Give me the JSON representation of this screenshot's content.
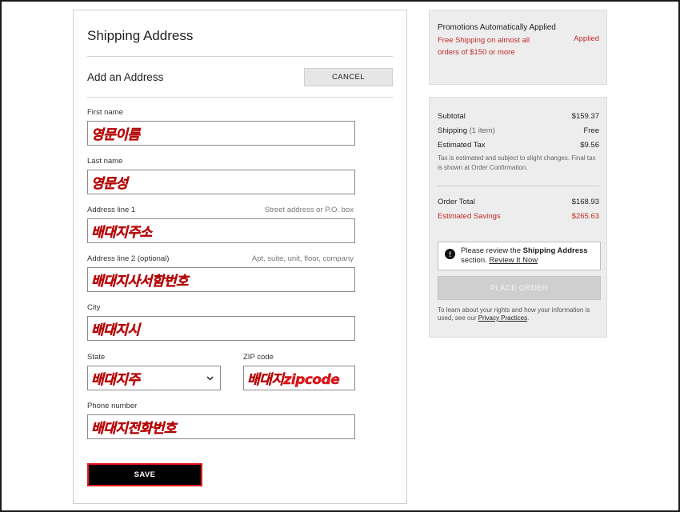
{
  "form": {
    "page_title": "Shipping Address",
    "section_title": "Add an Address",
    "cancel_label": "CANCEL",
    "first_name": {
      "label": "First name",
      "value": "영문이름"
    },
    "last_name": {
      "label": "Last name",
      "value": "영문성"
    },
    "address1": {
      "label": "Address line 1",
      "hint": "Street address or P.O. box",
      "value": "배대지주소"
    },
    "address2": {
      "label": "Address line 2 (optional)",
      "hint": "Apt, suite, unit, floor, company",
      "value": "배대지사서함번호"
    },
    "city": {
      "label": "City",
      "value": "배대지시"
    },
    "state": {
      "label": "State",
      "value": "배대지주"
    },
    "zip": {
      "label": "ZIP code",
      "value": "배대지zipcode"
    },
    "phone": {
      "label": "Phone number",
      "value": "배대지전화번호"
    },
    "save_label": "SAVE"
  },
  "promo": {
    "title": "Promotions Automatically Applied",
    "text": "Free Shipping on almost all orders of $150 or more",
    "status": "Applied"
  },
  "summary": {
    "subtotal_label": "Subtotal",
    "subtotal_value": "$159.37",
    "shipping_label": "Shipping",
    "shipping_count": "(1 item)",
    "shipping_value": "Free",
    "tax_label": "Estimated Tax",
    "tax_value": "$9.56",
    "tax_note": "Tax is estimated and subject to slight changes. Final tax is shown at Order Confirmation.",
    "total_label": "Order Total",
    "total_value": "$168.93",
    "savings_label": "Estimated Savings",
    "savings_value": "$265.63",
    "notice_prefix": "Please review the",
    "notice_bold": "Shipping Address",
    "notice_mid": "section.",
    "notice_link": "Review It Now",
    "place_order_label": "PLACE ORDER",
    "rights_text": "To learn about your rights and how your information is used, see our",
    "rights_link": "Privacy Practices",
    "rights_end": "."
  },
  "icons": {
    "chevron": "chevron-down-icon",
    "notice": "exclamation-icon"
  }
}
